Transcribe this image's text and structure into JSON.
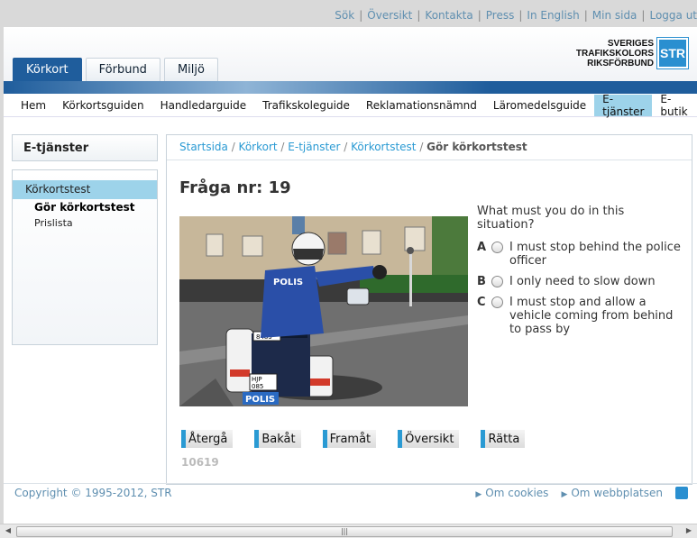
{
  "top_links": [
    "Sök",
    "Översikt",
    "Kontakta",
    "Press",
    "In English",
    "Min sida",
    "Logga ut"
  ],
  "tabs": [
    {
      "label": "Körkort",
      "active": true
    },
    {
      "label": "Förbund",
      "active": false
    },
    {
      "label": "Miljö",
      "active": false
    }
  ],
  "logo": {
    "line1": "SVERIGES",
    "line2": "TRAFIKSKOLORS",
    "line3": "RIKSFÖRBUND",
    "mark": "STR"
  },
  "mainnav": [
    {
      "label": "Hem",
      "active": false
    },
    {
      "label": "Körkortsguiden",
      "active": false
    },
    {
      "label": "Handledarguide",
      "active": false
    },
    {
      "label": "Trafikskoleguide",
      "active": false
    },
    {
      "label": "Reklamationsnämnd",
      "active": false
    },
    {
      "label": "Läromedelsguide",
      "active": false
    },
    {
      "label": "E-tjänster",
      "active": true
    },
    {
      "label": "E-butik",
      "active": false
    }
  ],
  "sidebar": {
    "title": "E-tjänster",
    "active_item": "Körkortstest",
    "sub_items": [
      "Gör körkortstest",
      "Prislista"
    ]
  },
  "breadcrumb": {
    "items": [
      "Startsida",
      "Körkort",
      "E-tjänster",
      "Körkortstest"
    ],
    "current": "Gör körkortstest"
  },
  "question": {
    "title": "Fråga nr: 19",
    "text": "What must you do in this situation?",
    "image_plate": "POLIS",
    "answers": [
      {
        "letter": "A",
        "text": "I must stop behind the police officer"
      },
      {
        "letter": "B",
        "text": "I only need to slow down"
      },
      {
        "letter": "C",
        "text": "I must stop and allow a vehicle coming from behind to pass by"
      }
    ]
  },
  "buttons": [
    "Återgå",
    "Bakåt",
    "Framåt",
    "Översikt",
    "Rätta"
  ],
  "code": "10619",
  "footer": {
    "copyright": "Copyright © 1995-2012, STR",
    "links": [
      "Om cookies",
      "Om webbplatsen"
    ]
  },
  "colors": {
    "brand_blue": "#1f5d9c",
    "accent_cyan": "#9dd3ea",
    "link": "#2a9ad3"
  }
}
